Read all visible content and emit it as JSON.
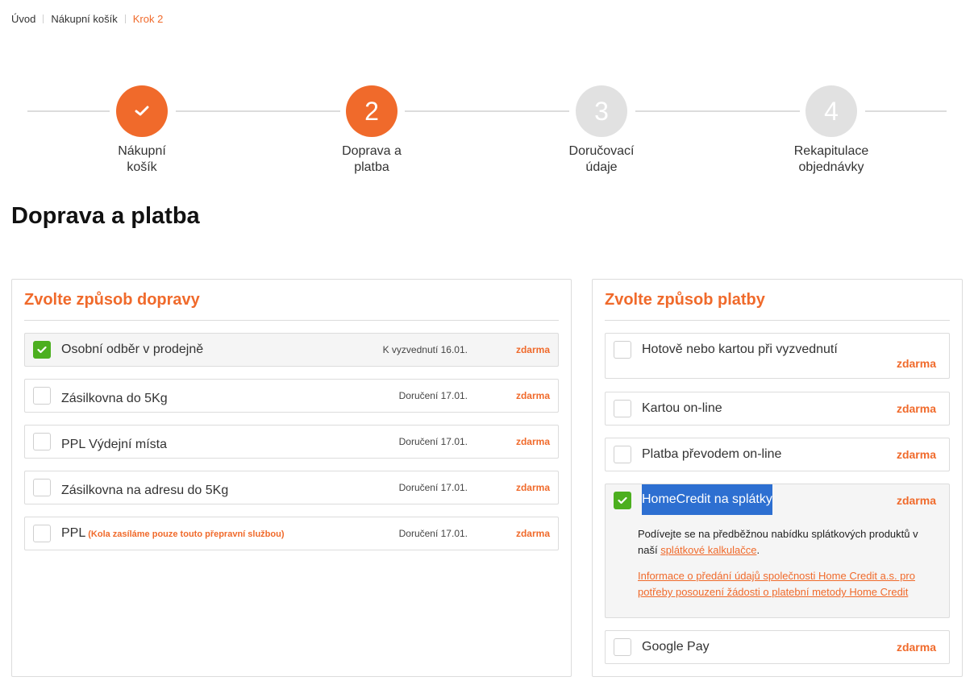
{
  "breadcrumb": {
    "home": "Úvod",
    "cart": "Nákupní košík",
    "current": "Krok 2"
  },
  "steps": [
    {
      "number": "✔",
      "line1": "Nákupní",
      "line2": "košík",
      "state": "done"
    },
    {
      "number": "2",
      "line1": "Doprava a",
      "line2": "platba",
      "state": "active"
    },
    {
      "number": "3",
      "line1": "Doručovací",
      "line2": "údaje",
      "state": "todo"
    },
    {
      "number": "4",
      "line1": "Rekapitulace",
      "line2": "objednávky",
      "state": "todo"
    }
  ],
  "page_title": "Doprava a platba",
  "shipping": {
    "title": "Zvolte způsob dopravy",
    "options": [
      {
        "label": "Osobní odběr v prodejně",
        "note": "",
        "date": "K vyzvednutí 16.01.",
        "price": "zdarma",
        "checked": true
      },
      {
        "label": "Zásilkovna do 5Kg",
        "note": "",
        "date": "Doručení 17.01.",
        "price": "zdarma",
        "checked": false
      },
      {
        "label": "PPL Výdejní místa",
        "note": "",
        "date": "Doručení 17.01.",
        "price": "zdarma",
        "checked": false
      },
      {
        "label": "Zásilkovna na adresu do 5Kg",
        "note": "",
        "date": "Doručení 17.01.",
        "price": "zdarma",
        "checked": false
      },
      {
        "label": "PPL",
        "note": "(Kola zasíláme pouze touto přepravní službou)",
        "date": "Doručení 17.01.",
        "price": "zdarma",
        "checked": false
      }
    ]
  },
  "payment": {
    "title": "Zvolte způsob platby",
    "options": [
      {
        "label": "Hotově nebo kartou při vyzvednutí",
        "price": "zdarma",
        "checked": false
      },
      {
        "label": "Kartou on-line",
        "price": "zdarma",
        "checked": false
      },
      {
        "label": "Platba převodem on-line",
        "price": "zdarma",
        "checked": false
      },
      {
        "label": "HomeCredit na splátky",
        "price": "zdarma",
        "checked": true
      },
      {
        "label": "Google Pay",
        "price": "zdarma",
        "checked": false
      }
    ],
    "homecredit": {
      "text_before": "Podívejte se na předběžnou nabídku splátkových produktů v naší",
      "calc_link": "splátkové kalkulačce",
      "text_after": ".",
      "info_link": "Informace o předání údajů společnosti Home Credit a.s. pro potřeby posouzení žádosti o platební metody Home Credit"
    }
  },
  "colors": {
    "accent": "#f06a2b",
    "checked": "#4caf1f",
    "step_inactive": "#e1e1e1",
    "selection": "#2d6fd1"
  },
  "icons": {
    "step_done": "checkmark-icon",
    "checkbox_checked": "checkmark-icon"
  }
}
